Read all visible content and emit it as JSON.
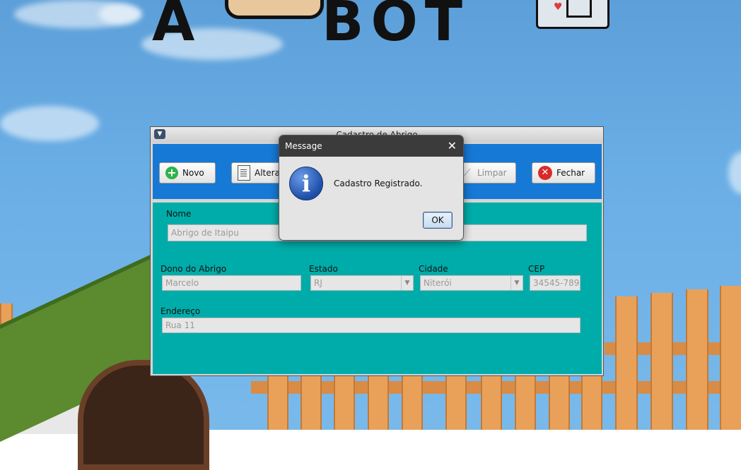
{
  "window": {
    "title": "Cadastro de Abrigo"
  },
  "toolbar": {
    "novo": "Novo",
    "alterar": "Altera",
    "limpar": "Limpar",
    "fechar": "Fechar"
  },
  "form": {
    "nome_label": "Nome",
    "nome_value": "Abrigo de Itaipu",
    "dono_label": "Dono do Abrigo",
    "dono_value": "Marcelo",
    "estado_label": "Estado",
    "estado_value": "RJ",
    "cidade_label": "Cidade",
    "cidade_value": "Niterói",
    "cep_label": "CEP",
    "cep_value": "34545-789",
    "endereco_label": "Endereço",
    "endereco_value": "Rua 11"
  },
  "dialog": {
    "title": "Message",
    "message": "Cadastro Registrado.",
    "ok_label": "OK",
    "close_glyph": "✕",
    "info_glyph": "i"
  },
  "icons": [
    "plus-icon",
    "edit-document-icon",
    "broom-icon",
    "close-circle-icon",
    "info-icon",
    "window-menu-icon"
  ],
  "colors": {
    "toolbar": "#1679d6",
    "form": "#00aca9"
  }
}
